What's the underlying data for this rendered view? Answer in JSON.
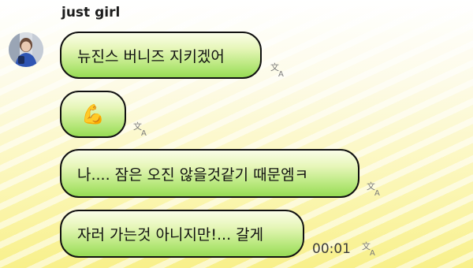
{
  "chat": {
    "sender_name": "just girl",
    "messages": [
      {
        "text": "뉴진스 버니즈 지키겠어"
      },
      {
        "emoji": "💪"
      },
      {
        "text": "나.... 잠은 오진 않을것같기 때문엠ㅋ"
      },
      {
        "text": "자러 가는것 아니지만!... 갈게",
        "time": "00:01"
      }
    ]
  },
  "icons": {
    "avatar": "profile-photo",
    "translate": "translate-icon"
  },
  "colors": {
    "bubble_top": "#fbfde8",
    "bubble_bottom": "#97dc55",
    "bubble_border": "#111111",
    "background_bottom": "#f8f08a"
  }
}
